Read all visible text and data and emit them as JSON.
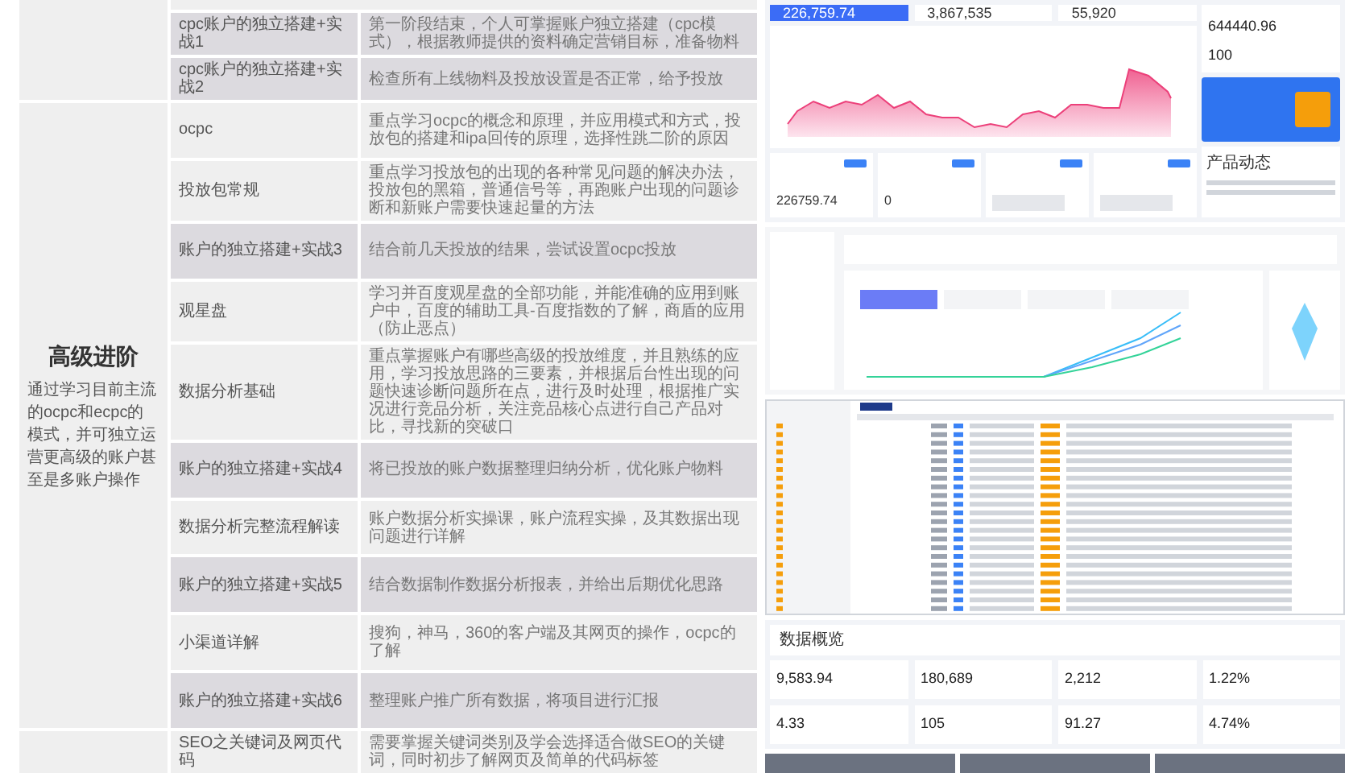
{
  "curriculum": {
    "sections": [
      {
        "rows": [
          {
            "course": "cpc账户的独立搭建+实战1",
            "detail": "第一阶段结束，个人可掌握账户独立搭建（cpc模式），根据教师提供的资料确定营销目标，准备物料",
            "highlighted": true
          },
          {
            "course": "cpc账户的独立搭建+实战2",
            "detail": "检查所有上线物料及投放设置是否正常，给予投放",
            "highlighted": true
          }
        ]
      },
      {
        "title": "高级进阶",
        "description": "通过学习目前主流的ocpc和ecpc的模式，并可独立运营更高级的账户甚至是多账户操作",
        "rows": [
          {
            "course": "ocpc",
            "detail": "重点学习ocpc的概念和原理，并应用模式和方式，投放包的搭建和ipa回传的原理，选择性跳二阶的原因",
            "highlighted": false
          },
          {
            "course": "投放包常规",
            "detail": "重点学习投放包的出现的各种常见问题的解决办法，投放包的黑箱，普通信号等，再跑账户出现的问题诊断和新账户需要快速起量的方法",
            "highlighted": false
          },
          {
            "course": "账户的独立搭建+实战3",
            "detail": "结合前几天投放的结果，尝试设置ocpc投放",
            "highlighted": true
          },
          {
            "course": "观星盘",
            "detail": "学习并百度观星盘的全部功能，并能准确的应用到账户中，百度的辅助工具-百度指数的了解，商盾的应用（防止恶点）",
            "highlighted": false
          },
          {
            "course": "数据分析基础",
            "detail": "重点掌握账户有哪些高级的投放维度，并且熟练的应用，学习投放思路的三要素，并根据后台性出现的问题快速诊断问题所在点，进行及时处理，根据推广实况进行竞品分析，关注竞品核心点进行自己产品对比，寻找新的突破口",
            "highlighted": false
          },
          {
            "course": "账户的独立搭建+实战4",
            "detail": "将已投放的账户数据整理归纳分析，优化账户物料",
            "highlighted": true
          },
          {
            "course": "数据分析完整流程解读",
            "detail": "账户数据分析实操课，账户流程实操，及其数据出现问题进行详解",
            "highlighted": false
          },
          {
            "course": "账户的独立搭建+实战5",
            "detail": "结合数据制作数据分析报表，并给出后期优化思路",
            "highlighted": true
          },
          {
            "course": "小渠道详解",
            "detail": "搜狗，神马，360的客户端及其网页的操作，ocpc的了解",
            "highlighted": false
          },
          {
            "course": "账户的独立搭建+实战6",
            "detail": "整理账户推广所有数据，将项目进行汇报",
            "highlighted": true
          }
        ]
      },
      {
        "rows": [
          {
            "course": "SEO之关键词及网页代码",
            "detail": "需要掌握关键词类别及学会选择适合做SEO的关键词，同时初步了解网页及简单的代码标签",
            "highlighted": false
          }
        ]
      }
    ]
  },
  "dashboard": {
    "stat_cards": [
      {
        "value": "226,759.74",
        "kind": "primary"
      },
      {
        "value": "3,867,535",
        "kind": "plain"
      },
      {
        "value": "55,920",
        "kind": "plain"
      }
    ],
    "balance": {
      "value": "644440.96",
      "count": "100"
    },
    "promo_values": [
      "226759.74",
      "0"
    ],
    "news_title": "产品动态"
  },
  "overview": {
    "title": "数据概览",
    "metrics": [
      "9,583.94",
      "180,689",
      "2,212",
      "1.22%",
      "4.33",
      "105",
      "91.27",
      "4.74%"
    ]
  }
}
